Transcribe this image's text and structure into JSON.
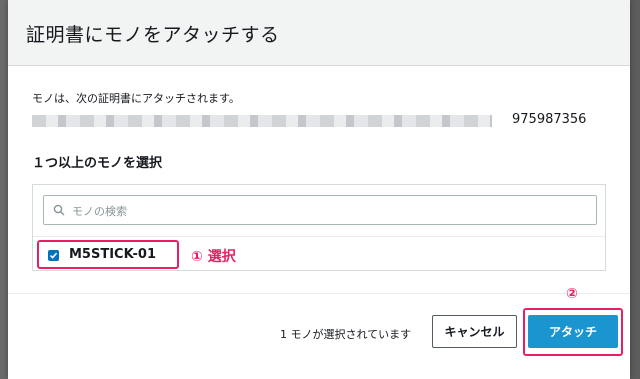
{
  "modal": {
    "title": "証明書にモノをアタッチする",
    "description": "モノは、次の証明書にアタッチされます。",
    "certificate_id_visible": "975987356",
    "section_title": "１つ以上のモノを選択"
  },
  "search": {
    "placeholder": "モノの検索"
  },
  "things": [
    {
      "label": "M5STICK-01",
      "checked": true
    }
  ],
  "annotations": {
    "step1": "① 選択",
    "step2": "②",
    "color": "#e91e63"
  },
  "footer": {
    "status": "1 モノが選択されています",
    "cancel_label": "キャンセル",
    "attach_label": "アタッチ"
  },
  "colors": {
    "primary": "#1a95d0",
    "checkbox": "#0073bb",
    "header_bg": "#f2f3f3"
  }
}
